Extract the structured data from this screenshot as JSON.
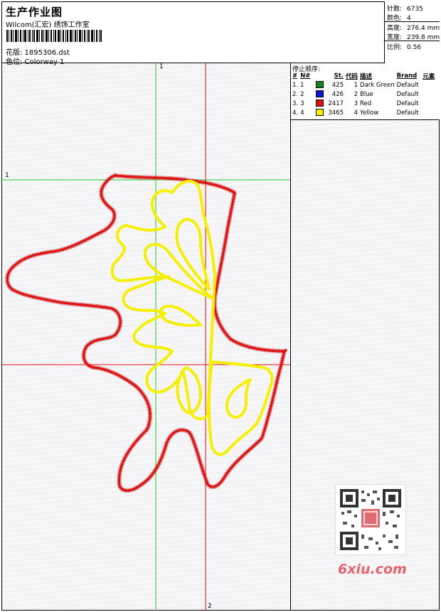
{
  "header": {
    "title": "生产作业图",
    "subtitle": "Wilcom(汇宏) 绣饰工作室",
    "design": "花版: 1895306.dst",
    "colorway": "色位: Colorway 1"
  },
  "stats": [
    {
      "label": "针数:",
      "value": "6735"
    },
    {
      "label": "颜色:",
      "value": "4"
    },
    {
      "label": "高度:",
      "value": "276.4 mm"
    },
    {
      "label": "宽度:",
      "value": "239.8 mm"
    },
    {
      "label": "比例:",
      "value": "0.56"
    }
  ],
  "sequence": {
    "title": "停止顺序:",
    "columns": [
      "#",
      "N#",
      "St.",
      "代码",
      "描述",
      "Brand",
      "元素"
    ],
    "rows": [
      {
        "num": "1.",
        "n": "1",
        "color": "#0d8a1e",
        "st": "425",
        "code": "1",
        "desc": "Dark Green",
        "brand": "Default"
      },
      {
        "num": "2.",
        "n": "2",
        "color": "#0a16d6",
        "st": "426",
        "code": "2",
        "desc": "Blue",
        "brand": "Default"
      },
      {
        "num": "3.",
        "n": "3",
        "color": "#e01010",
        "st": "2417",
        "code": "3",
        "desc": "Red",
        "brand": "Default"
      },
      {
        "num": "4.",
        "n": "4",
        "color": "#f5ef00",
        "st": "3465",
        "code": "4",
        "desc": "Yellow",
        "brand": "Default"
      }
    ]
  },
  "axes": {
    "green_label_top": "1",
    "green_label_left": "1",
    "red_label_bottom": "2"
  },
  "watermark": "6xiu.com",
  "colors": {
    "outline": "#e01010",
    "fill_motif": "#f5ef00",
    "guide_green": "#22cc22",
    "guide_red": "#e01010"
  }
}
